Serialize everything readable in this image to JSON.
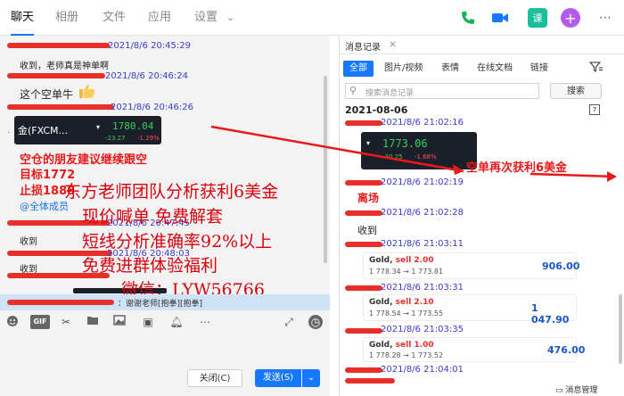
{
  "nav": {
    "tabs": [
      "聊天",
      "相册",
      "文件",
      "应用",
      "设置"
    ],
    "settings_chevron": "⌄"
  },
  "chat": {
    "timestamps": [
      "2021/8/6 20:45:29",
      "2021/8/6 20:46:24",
      "2021/8/6 20:46:26",
      "2021/8/6 20:47:45",
      "2021/8/6 20:48:03"
    ],
    "messages": {
      "m1": "收到，老师真是神单啊",
      "m2": "这个空单牛",
      "m3_prefix": "金(FXCM...",
      "m4": "收到",
      "m5": "收到"
    },
    "ticker": {
      "price": "1780.04",
      "change": "-23.27",
      "pct": "-1.29%"
    },
    "red_lines": [
      "空仓的朋友建议继续跟空",
      "目标1772",
      "止损1888"
    ],
    "mention": "@全体成员",
    "overlay": [
      "东方老师团队分析获利6美金",
      "现价喊单    免费解套",
      "短线分析准确率92%以上",
      "免费进群体验福利",
      "微信：LYW56766"
    ],
    "input_quote": "：谢谢老师[抱拳][抱拳]",
    "buttons": {
      "close": "关闭(C)",
      "send": "发送(S)"
    }
  },
  "history": {
    "title": "消息记录",
    "close": "×",
    "tabs": [
      "全部",
      "图片/视频",
      "表情",
      "在线文档",
      "链接"
    ],
    "search_placeholder": "搜索消息记录",
    "search_button": "搜索",
    "date": "2021-08-06",
    "timestamps": [
      "2021/8/6 21:02:16",
      "2021/8/6 21:02:19",
      "2021/8/6 21:02:28",
      "2021/8/6 21:03:11",
      "2021/8/6 21:03:31",
      "2021/8/6 21:03:35",
      "2021/8/6 21:04:01"
    ],
    "ticker": {
      "price": "1773.06",
      "change": "-30.25",
      "pct": "-1.68%"
    },
    "exit_text": "离场",
    "received": "收到",
    "annotation": "空单再次获利6美金",
    "trades": [
      {
        "asset": "Gold, ",
        "side": "sell 2.00",
        "prices": "1 778.34 → 1 773.81",
        "amount": "906.00"
      },
      {
        "asset": "Gold, ",
        "side": "sell 2.10",
        "prices": "1 778.54 → 1 773.55",
        "amount": "1 047.90"
      },
      {
        "asset": "Gold, ",
        "side": "sell 1.00",
        "prices": "1 778.28 → 1 773.52",
        "amount": "476.00"
      }
    ],
    "footer_link": "消息管理"
  },
  "colors": {
    "accent": "#1677ff",
    "redline": "#e8302a",
    "overlay_red": "#d9000d",
    "timestamp_blue": "#3a3ad0"
  }
}
